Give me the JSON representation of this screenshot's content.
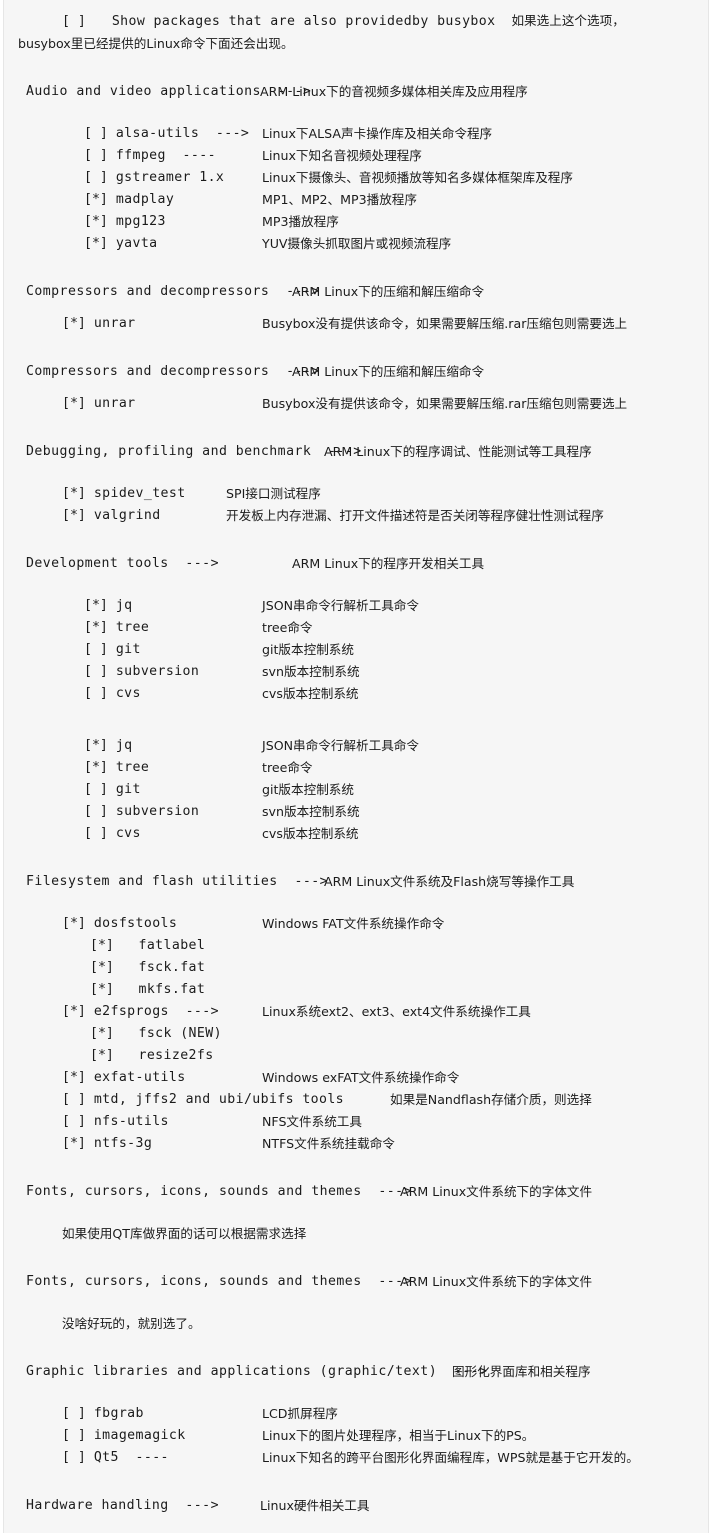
{
  "document": {
    "kind": "buildroot-menuconfig-annotated-listing",
    "top_note": {
      "checkbox": "[ ]",
      "option_label": "Show packages that are also providedby busybox",
      "note_inline": "如果选上这个选项，",
      "note_second_line": "busybox里已经提供的Linux命令下面还会出现。"
    },
    "sections": [
      {
        "title": "Audio and video applications  --->",
        "note": "ARM Linux下的音视频多媒体相关库及应用程序",
        "title_indent": 22,
        "note_indent": 278,
        "items": [
          {
            "box": "[ ]",
            "name": "alsa-utils  --->",
            "desc": "Linux下ALSA声卡操作库及相关命令程序",
            "indent": 80,
            "desc_indent": 258
          },
          {
            "box": "[ ]",
            "name": "ffmpeg  ----",
            "desc": "Linux下知名音视频处理程序",
            "indent": 80,
            "desc_indent": 258
          },
          {
            "box": "[ ]",
            "name": "gstreamer 1.x",
            "desc": "Linux下摄像头、音视频播放等知名多媒体框架库及程序",
            "indent": 80,
            "desc_indent": 258
          },
          {
            "box": "[*]",
            "name": "madplay",
            "desc": "MP1、MP2、MP3播放程序",
            "indent": 80,
            "desc_indent": 258
          },
          {
            "box": "[*]",
            "name": "mpg123",
            "desc": "MP3播放程序",
            "indent": 80,
            "desc_indent": 258
          },
          {
            "box": "[*]",
            "name": "yavta",
            "desc": "YUV摄像头抓取图片或视频流程序",
            "indent": 80,
            "desc_indent": 258
          }
        ]
      },
      {
        "title": "Compressors and decompressors  --->",
        "note": "ARM Linux下的压缩和解压缩命令",
        "title_indent": 22,
        "note_indent": 310,
        "items": [
          {
            "box": "[*]",
            "name": "unrar",
            "desc": "Busybox没有提供该命令，如果需要解压缩.rar压缩包则需要选上",
            "indent": 58,
            "desc_indent": 258
          }
        ]
      },
      {
        "title": "Compressors and decompressors  --->",
        "note": "ARM Linux下的压缩和解压缩命令",
        "title_indent": 22,
        "note_indent": 310,
        "items": [
          {
            "box": "[*]",
            "name": "unrar",
            "desc": "Busybox没有提供该命令，如果需要解压缩.rar压缩包则需要选上",
            "indent": 58,
            "desc_indent": 258
          }
        ]
      },
      {
        "title": "Debugging, profiling and benchmark  --->",
        "note": "ARM Linux下的程序调试、性能测试等工具程序",
        "title_indent": 22,
        "note_indent": 342,
        "items": [
          {
            "box": "[*]",
            "name": "spidev_test",
            "desc": "SPI接口测试程序",
            "indent": 58,
            "desc_indent": 222
          },
          {
            "box": "[*]",
            "name": "valgrind",
            "desc": "开发板上内存泄漏、打开文件描述符是否关闭等程序健壮性测试程序",
            "indent": 58,
            "desc_indent": 222
          }
        ]
      },
      {
        "title": "Development tools  --->",
        "note": "ARM Linux下的程序开发相关工具",
        "title_indent": 22,
        "note_indent": 310,
        "items": [
          {
            "box": "[*]",
            "name": "jq",
            "desc": "JSON串命令行解析工具命令",
            "indent": 80,
            "desc_indent": 258
          },
          {
            "box": "[*]",
            "name": "tree",
            "desc": "tree命令",
            "indent": 80,
            "desc_indent": 258
          },
          {
            "box": "[ ]",
            "name": "git",
            "desc": "git版本控制系统",
            "indent": 80,
            "desc_indent": 258
          },
          {
            "box": "[ ]",
            "name": "subversion",
            "desc": "svn版本控制系统",
            "indent": 80,
            "desc_indent": 258
          },
          {
            "box": "[ ]",
            "name": "cvs",
            "desc": "cvs版本控制系统",
            "indent": 80,
            "desc_indent": 258
          }
        ]
      },
      {
        "title": "",
        "note": "",
        "title_indent": 22,
        "note_indent": 310,
        "items": [
          {
            "box": "[*]",
            "name": "jq",
            "desc": "JSON串命令行解析工具命令",
            "indent": 80,
            "desc_indent": 258
          },
          {
            "box": "[*]",
            "name": "tree",
            "desc": "tree命令",
            "indent": 80,
            "desc_indent": 258
          },
          {
            "box": "[ ]",
            "name": "git",
            "desc": "git版本控制系统",
            "indent": 80,
            "desc_indent": 258
          },
          {
            "box": "[ ]",
            "name": "subversion",
            "desc": "svn版本控制系统",
            "indent": 80,
            "desc_indent": 258
          },
          {
            "box": "[ ]",
            "name": "cvs",
            "desc": "cvs版本控制系统",
            "indent": 80,
            "desc_indent": 258
          }
        ]
      },
      {
        "title": "Filesystem and flash utilities  --->",
        "note": "ARM Linux文件系统及Flash烧写等操作工具",
        "title_indent": 22,
        "note_indent": 342,
        "items": [
          {
            "box": "[*]",
            "name": "dosfstools",
            "desc": "Windows FAT文件系统操作命令",
            "indent": 58,
            "desc_indent": 258
          },
          {
            "box": "[*]",
            "name": "  fatlabel",
            "desc": "",
            "indent": 86,
            "desc_indent": 258
          },
          {
            "box": "[*]",
            "name": "  fsck.fat",
            "desc": "",
            "indent": 86,
            "desc_indent": 258
          },
          {
            "box": "[*]",
            "name": "  mkfs.fat",
            "desc": "",
            "indent": 86,
            "desc_indent": 258
          },
          {
            "box": "[*]",
            "name": "e2fsprogs  --->",
            "desc": "Linux系统ext2、ext3、ext4文件系统操作工具",
            "indent": 58,
            "desc_indent": 258
          },
          {
            "box": "[*]",
            "name": "  fsck (NEW)",
            "desc": "",
            "indent": 86,
            "desc_indent": 258
          },
          {
            "box": "[*]",
            "name": "  resize2fs",
            "desc": "",
            "indent": 86,
            "desc_indent": 258
          },
          {
            "box": "[*]",
            "name": "exfat-utils",
            "desc": "Windows exFAT文件系统操作命令",
            "indent": 58,
            "desc_indent": 258
          },
          {
            "box": "[ ]",
            "name": "mtd, jffs2 and ubi/ubifs tools",
            "desc": "如果是Nandflash存储介质，则选择",
            "indent": 58,
            "desc_indent": 386
          },
          {
            "box": "[ ]",
            "name": "nfs-utils",
            "desc": "NFS文件系统工具",
            "indent": 58,
            "desc_indent": 258
          },
          {
            "box": "[*]",
            "name": "ntfs-3g",
            "desc": "NTFS文件系统挂载命令",
            "indent": 58,
            "desc_indent": 258
          }
        ]
      },
      {
        "title": "Fonts, cursors, icons, sounds and themes  --->",
        "note": "ARM Linux文件系统下的字体文件",
        "title_indent": 22,
        "note_indent": 418,
        "paragraph": "如果使用QT库做界面的话可以根据需求选择",
        "paragraph_indent": 58,
        "items": []
      },
      {
        "title": "Fonts, cursors, icons, sounds and themes  --->",
        "note": "ARM Linux文件系统下的字体文件",
        "title_indent": 22,
        "note_indent": 418,
        "paragraph": "没啥好玩的，就别选了。",
        "paragraph_indent": 58,
        "items": []
      },
      {
        "title": "Graphic libraries and applications (graphic/text)  --->",
        "note": "图形化界面库和相关程序",
        "title_indent": 22,
        "note_indent": 470,
        "items": [
          {
            "box": "[ ]",
            "name": "fbgrab",
            "desc": "LCD抓屏程序",
            "indent": 58,
            "desc_indent": 258
          },
          {
            "box": "[ ]",
            "name": "imagemagick",
            "desc": "Linux下的图片处理程序，相当于Linux下的PS。",
            "indent": 58,
            "desc_indent": 258
          },
          {
            "box": "[ ]",
            "name": "Qt5  ----",
            "desc": "Linux下知名的跨平台图形化界面编程库，WPS就是基于它开发的。",
            "indent": 58,
            "desc_indent": 258
          }
        ]
      },
      {
        "title": "Hardware handling  --->",
        "note": "Linux硬件相关工具",
        "title_indent": 22,
        "note_indent": 278,
        "items": []
      }
    ]
  }
}
